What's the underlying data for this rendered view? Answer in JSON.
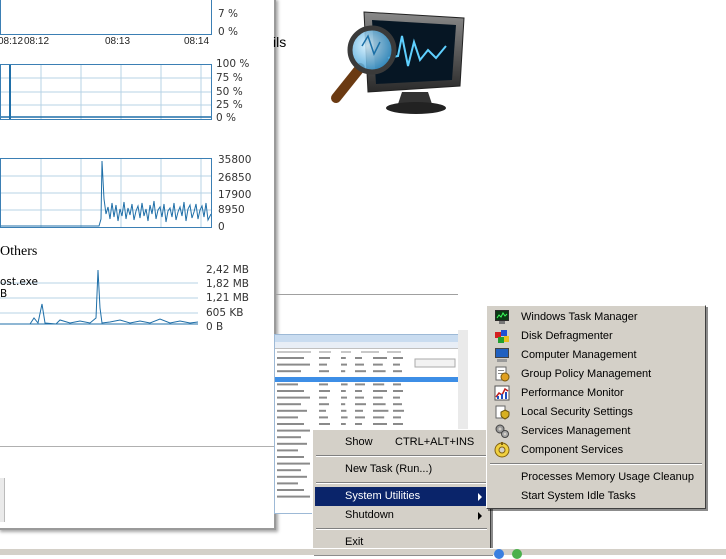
{
  "monitor": {
    "cpu": {
      "pct_labels": [
        "7 %",
        "0 %"
      ],
      "time_labels": [
        "08:12",
        "08:13",
        "08:14"
      ]
    },
    "mem": {
      "pct_labels": [
        "100 %",
        "75 %",
        "50 %",
        "25 %",
        "0 %"
      ]
    },
    "net": {
      "labels": [
        "35800",
        "26850",
        "17900",
        "8950",
        "0"
      ]
    },
    "others": {
      "title": "Others",
      "process": "ost.exe",
      "unit": "B",
      "labels": [
        "2,42 MB",
        "1,82 MB",
        "1,21 MB",
        "605 KB",
        "0 B"
      ]
    }
  },
  "background": {
    "partial_text": "ils"
  },
  "context_menu": {
    "items": [
      "Show",
      "New Task  (Run...)",
      "System Utilities",
      "Shutdown",
      "Exit"
    ],
    "show_shortcut": "CTRL+ALT+INS",
    "selected": "System Utilities"
  },
  "system_utilities_menu": {
    "items": [
      {
        "label": "Windows Task Manager",
        "icon": "task-manager-icon"
      },
      {
        "label": "Disk Defragmenter",
        "icon": "defrag-icon"
      },
      {
        "label": "Computer Management",
        "icon": "computer-management-icon"
      },
      {
        "label": "Group Policy Management",
        "icon": "group-policy-icon"
      },
      {
        "label": "Performance Monitor",
        "icon": "performance-monitor-icon"
      },
      {
        "label": "Local Security Settings",
        "icon": "security-settings-icon"
      },
      {
        "label": "Services Management",
        "icon": "services-icon"
      },
      {
        "label": "Component Services",
        "icon": "component-services-icon"
      },
      {
        "label": "Processes Memory Usage Cleanup",
        "icon": ""
      },
      {
        "label": "Start System Idle Tasks",
        "icon": ""
      }
    ]
  },
  "colors": {
    "menu_bg": "#d4d0c8",
    "highlight": "#0a246a",
    "graph_line": "#1f6fa8",
    "grid": "#9ec3dc"
  }
}
